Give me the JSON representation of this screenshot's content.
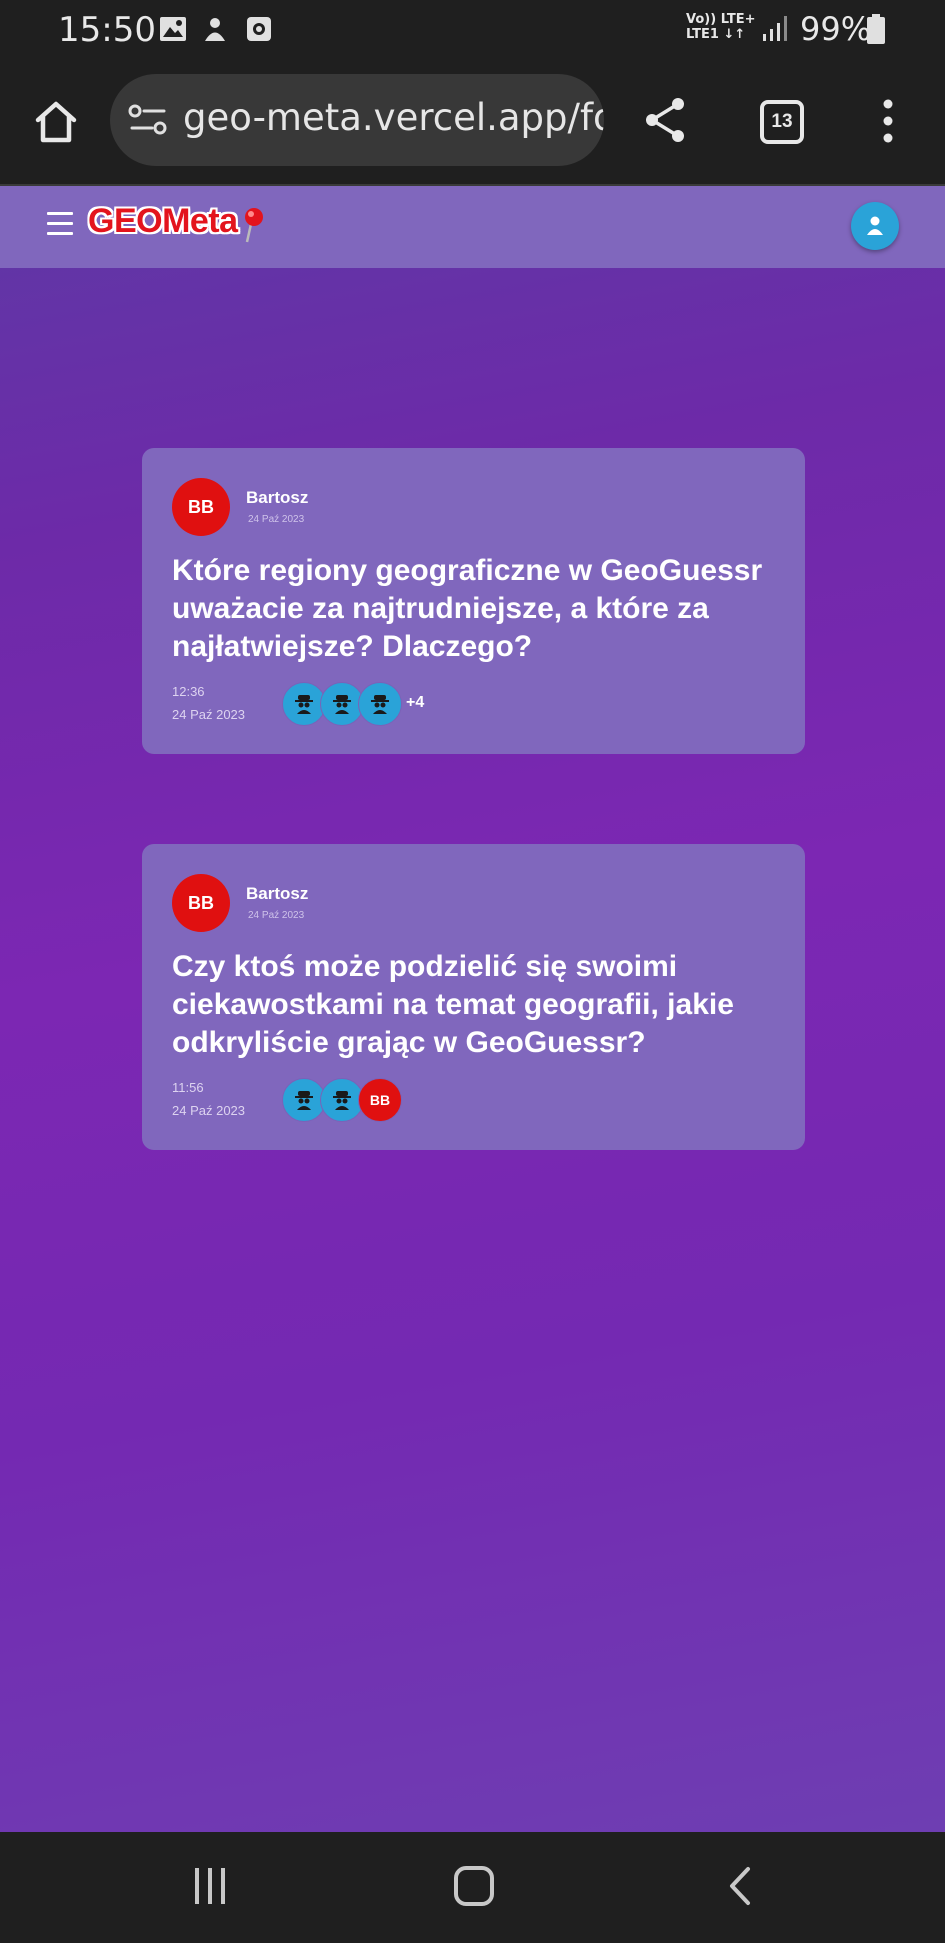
{
  "status_bar": {
    "time": "15:50",
    "network_line1": "Vo)) LTE+",
    "network_line2": "LTE1 ↓↑",
    "battery": "99%",
    "icons": [
      "gallery-icon",
      "sync-icon",
      "screen-recorder-icon",
      "signal-icon",
      "battery-icon"
    ]
  },
  "browser": {
    "url": "geo-meta.vercel.app/fo",
    "tab_count": "13",
    "icons": [
      "home-icon",
      "site-settings-icon",
      "share-icon",
      "more-vert-icon"
    ]
  },
  "app": {
    "logo": "GEOMeta",
    "colors": {
      "appbar": "#8067bd",
      "accent": "#2aa3d8",
      "avatar_red": "#e01010",
      "logo_red": "#e3141d"
    }
  },
  "posts": [
    {
      "author_initials": "BB",
      "author_name": "Bartosz",
      "author_date": "24 Paź 2023",
      "title": "Które regiony geograficzne w GeoGuessr uważacie za najtrudniejsze, a które za najłatwiejsze? Dlaczego?",
      "time": "12:36",
      "date": "24 Paź 2023",
      "participants": [
        "anon",
        "anon",
        "anon"
      ],
      "more": "+4"
    },
    {
      "author_initials": "BB",
      "author_name": "Bartosz",
      "author_date": "24 Paź 2023",
      "title": "Czy ktoś może podzielić się swoimi ciekawostkami na temat geografii, jakie odkryliście grając w GeoGuessr?",
      "time": "11:56",
      "date": "24 Paź 2023",
      "participants": [
        "anon",
        "anon",
        "BB"
      ],
      "more": ""
    }
  ]
}
